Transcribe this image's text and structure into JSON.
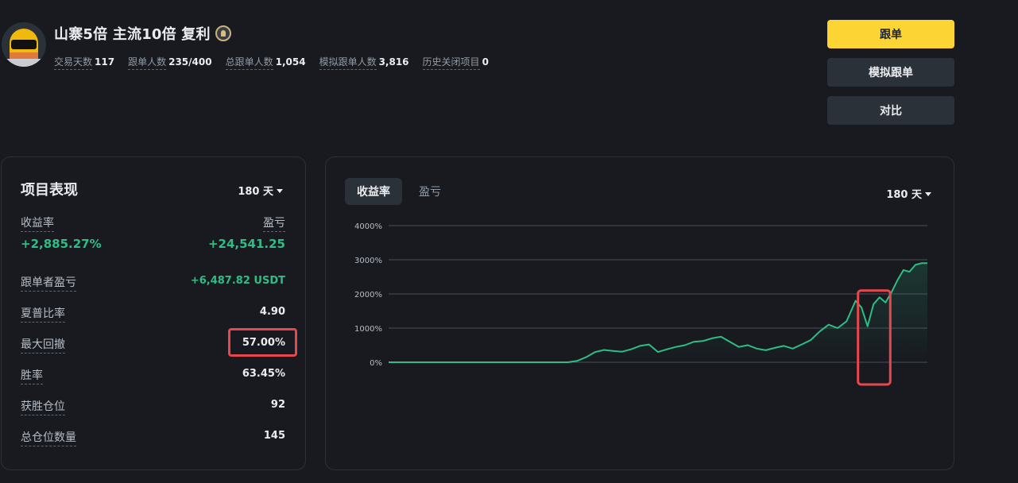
{
  "header": {
    "title": "山寨5倍 主流10倍 复利",
    "stats": [
      {
        "label": "交易天数",
        "value": "117"
      },
      {
        "label": "跟单人数",
        "value": "235/400"
      },
      {
        "label": "总跟单人数",
        "value": "1,054"
      },
      {
        "label": "模拟跟单人数",
        "value": "3,816"
      },
      {
        "label": "历史关闭项目",
        "value": "0"
      }
    ]
  },
  "actions": {
    "copy": "跟单",
    "sim_copy": "模拟跟单",
    "compare": "对比"
  },
  "performance": {
    "title": "项目表现",
    "period": "180 天",
    "roi_label": "收益率",
    "roi_value": "+2,885.27%",
    "pnl_label": "盈亏",
    "pnl_value": "+24,541.25",
    "rows": [
      {
        "label": "跟单者盈亏",
        "value": "+6,487.82 USDT"
      },
      {
        "label": "夏普比率",
        "value": "4.90"
      },
      {
        "label": "最大回撤",
        "value": "57.00%"
      },
      {
        "label": "胜率",
        "value": "63.45%"
      },
      {
        "label": "获胜仓位",
        "value": "92"
      },
      {
        "label": "总仓位数量",
        "value": "145"
      }
    ]
  },
  "chart_panel": {
    "tabs": [
      "收益率",
      "盈亏"
    ],
    "active_tab": 0,
    "period": "180 天"
  },
  "colors": {
    "line": "#2ebd85",
    "accent": "#fcd535",
    "highlight": "#e5484d"
  },
  "chart_data": {
    "type": "line",
    "ylabel": "",
    "xlabel": "",
    "ylim": [
      0,
      4000
    ],
    "yticks": [
      "0%",
      "1000%",
      "2000%",
      "3000%",
      "4000%"
    ],
    "ytick_values": [
      0,
      1000,
      2000,
      3000,
      4000
    ],
    "x": [
      0,
      5,
      10,
      15,
      20,
      25,
      30,
      35,
      40,
      45,
      50,
      55,
      60,
      63,
      66,
      69,
      72,
      75,
      78,
      81,
      84,
      87,
      90,
      93,
      96,
      99,
      102,
      105,
      108,
      111,
      114,
      117,
      120,
      123,
      126,
      129,
      132,
      135,
      138,
      141,
      144,
      147,
      150,
      153,
      156,
      158,
      160,
      162,
      164,
      166,
      168,
      170,
      172,
      174,
      176,
      178,
      180
    ],
    "series": [
      {
        "name": "",
        "values": [
          0,
          0,
          0,
          0,
          0,
          0,
          0,
          0,
          0,
          0,
          0,
          0,
          0,
          40,
          150,
          300,
          360,
          330,
          310,
          380,
          480,
          520,
          300,
          380,
          450,
          500,
          600,
          620,
          700,
          750,
          600,
          450,
          500,
          400,
          350,
          420,
          480,
          400,
          520,
          650,
          900,
          1100,
          1000,
          1200,
          1800,
          1600,
          1050,
          1700,
          1900,
          1750,
          2050,
          2400,
          2700,
          2650,
          2850,
          2900,
          2900
        ]
      }
    ]
  }
}
